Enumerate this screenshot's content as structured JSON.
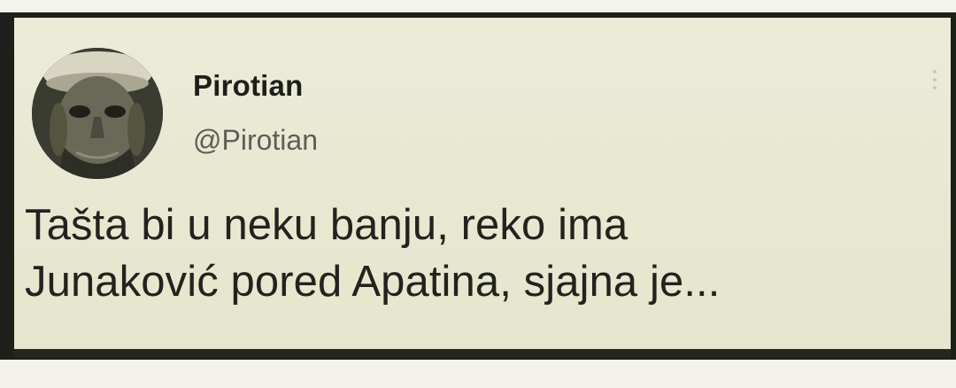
{
  "tweet": {
    "display_name": "Pirotian",
    "handle": "@Pirotian",
    "text_line1": "Tašta bi u neku banju, reko ima",
    "text_line2": "Junaković pored Apatina, sjajna je...",
    "avatar_icon": "avatar-photo",
    "more_icon": "more-options-icon"
  },
  "colors": {
    "card_background": "#e9e8d2",
    "frame": "#1d1f1a",
    "name_text": "#1e1f1a",
    "handle_text": "#5d5f57"
  }
}
